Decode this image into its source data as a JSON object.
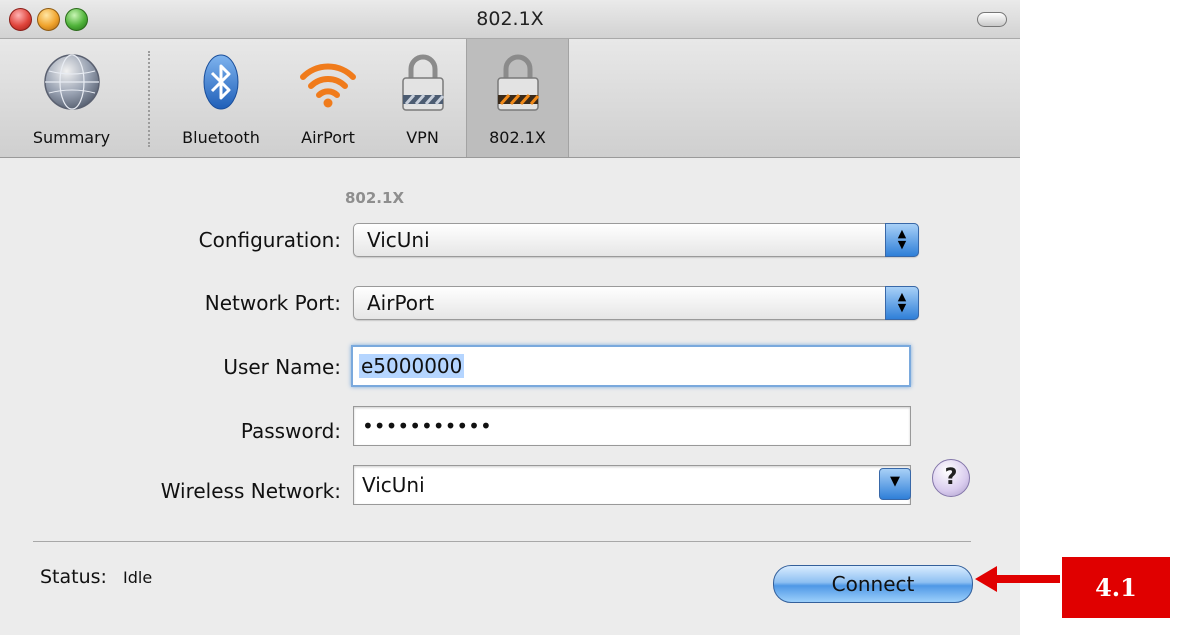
{
  "window": {
    "title": "802.1X"
  },
  "toolbar": {
    "items": [
      {
        "label": "Summary",
        "icon": "summary-globe-icon"
      },
      {
        "label": "Bluetooth",
        "icon": "bluetooth-icon"
      },
      {
        "label": "AirPort",
        "icon": "airport-wifi-icon"
      },
      {
        "label": "VPN",
        "icon": "vpn-lock-icon"
      },
      {
        "label": "802.1X",
        "icon": "8021x-lock-icon",
        "selected": true
      }
    ]
  },
  "section": {
    "title": "802.1X"
  },
  "form": {
    "configuration": {
      "label": "Configuration:",
      "value": "VicUni"
    },
    "network_port": {
      "label": "Network Port:",
      "value": "AirPort"
    },
    "user_name": {
      "label": "User Name:",
      "value": "e5000000"
    },
    "password": {
      "label": "Password:",
      "value": "•••••••••••"
    },
    "wireless_network": {
      "label": "Wireless Network:",
      "value": "VicUni"
    }
  },
  "help": {
    "glyph": "?"
  },
  "status": {
    "label": "Status:",
    "value": "Idle"
  },
  "connect_button": {
    "label": "Connect"
  },
  "callout": {
    "label": "4.1",
    "color": "#e00000"
  }
}
